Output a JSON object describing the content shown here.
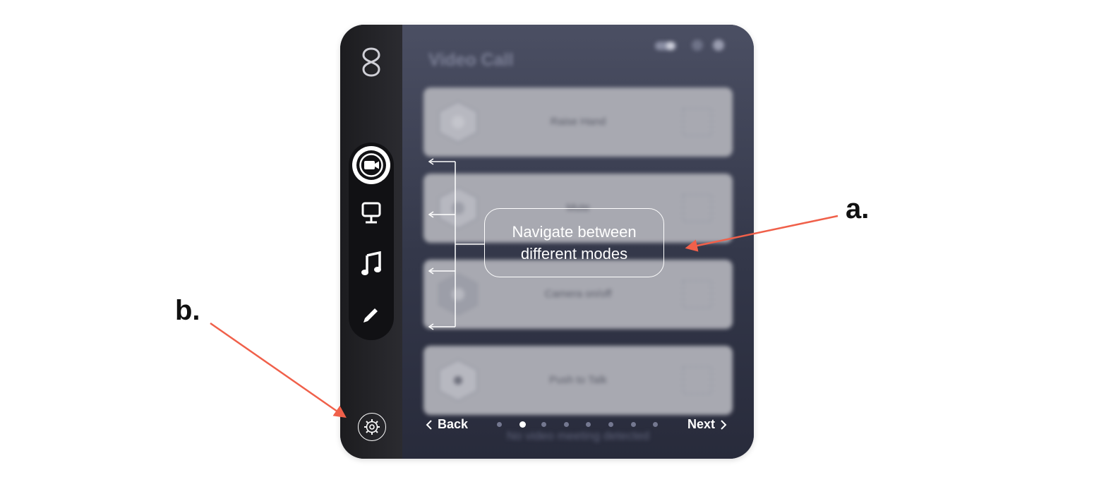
{
  "app": {
    "title": "Video Call",
    "cards": [
      {
        "label": "Raise Hand"
      },
      {
        "label": "Mute"
      },
      {
        "label": "Camera on/off"
      },
      {
        "label": "Push to Talk"
      }
    ],
    "status": "No video meeting detected",
    "back_label": "Back",
    "next_label": "Next",
    "page_dots": 8,
    "active_page": 2
  },
  "sidebar": {
    "modes": [
      {
        "icon": "video-camera-icon",
        "active": true
      },
      {
        "icon": "monitor-icon",
        "active": false
      },
      {
        "icon": "music-note-icon",
        "active": false
      },
      {
        "icon": "pencil-icon",
        "active": false
      }
    ],
    "settings_icon": "gear-icon"
  },
  "annotations": {
    "callout_line1": "Navigate between",
    "callout_line2": "different modes",
    "marker_a": "a.",
    "marker_b": "b.",
    "arrow_color": "#f0604a"
  },
  "colors": {
    "sidebar": "#1c1c1f",
    "content": "#333749",
    "card": "#a8a9b1"
  }
}
